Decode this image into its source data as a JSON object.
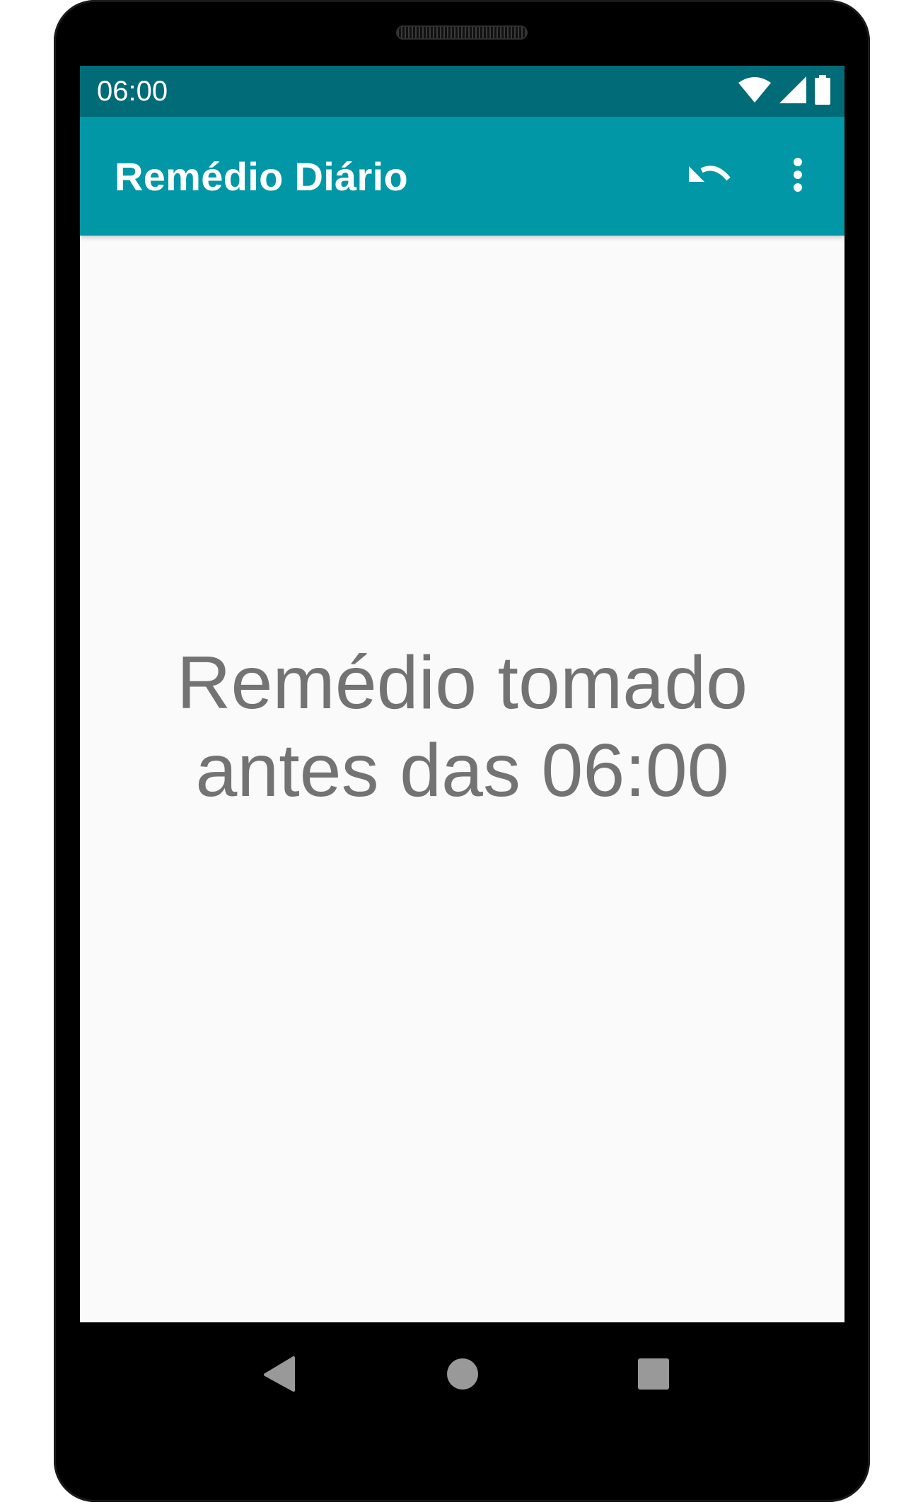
{
  "status_bar": {
    "time": "06:00",
    "icons": [
      "wifi-icon",
      "cellular-signal-icon",
      "battery-icon"
    ],
    "background": "#016b78"
  },
  "app_bar": {
    "title": "Remédio Diário",
    "background": "#0197a7",
    "actions": [
      "undo-icon",
      "more-vert-icon"
    ]
  },
  "main": {
    "message_line1": "Remédio tomado",
    "message_line2": "antes das 06:00",
    "text_color": "#737373",
    "background": "#fafafa"
  },
  "nav_bar": {
    "buttons": [
      "back-icon",
      "home-icon",
      "recents-icon"
    ]
  }
}
